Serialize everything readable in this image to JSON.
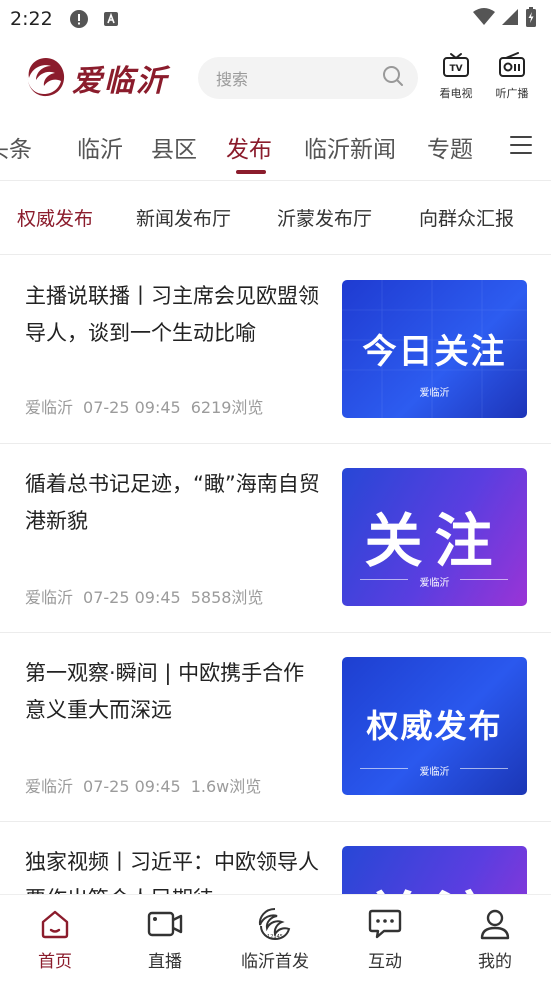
{
  "status_bar": {
    "time": "2:22"
  },
  "header": {
    "logo_text": "爱临沂",
    "search_placeholder": "搜索",
    "tv_label": "看电视",
    "radio_label": "听广播"
  },
  "tabs": [
    {
      "label": "头条"
    },
    {
      "label": "临沂"
    },
    {
      "label": "县区"
    },
    {
      "label": "发布"
    },
    {
      "label": "临沂新闻"
    },
    {
      "label": "专题"
    }
  ],
  "active_tab": "发布",
  "subtabs": [
    {
      "label": "权威发布"
    },
    {
      "label": "新闻发布厅"
    },
    {
      "label": "沂蒙发布厅"
    },
    {
      "label": "向群众汇报"
    }
  ],
  "news": [
    {
      "title": "主播说联播丨习主席会见欧盟领导人，谈到一个生动比喻",
      "source": "爱临沂",
      "time": "07-25 09:45",
      "views": "6219浏览",
      "thumb_text": "今日关注",
      "thumb_logo": "爱临沂"
    },
    {
      "title": "循着总书记足迹，“瞰”海南自贸港新貌",
      "source": "爱临沂",
      "time": "07-25 09:45",
      "views": "5858浏览",
      "thumb_text": "关注",
      "thumb_logo": "爱临沂"
    },
    {
      "title": "第一观察·瞬间 | 中欧携手合作意义重大而深远",
      "source": "爱临沂",
      "time": "07-25 09:45",
      "views": "1.6w浏览",
      "thumb_text": "权威发布",
      "thumb_logo": "爱临沂"
    },
    {
      "title": "独家视频丨习近平：中欧领导人要作出符合人民期待",
      "thumb_text": "关注"
    }
  ],
  "bottom_nav": [
    {
      "label": "首页"
    },
    {
      "label": "直播"
    },
    {
      "label": "临沂首发"
    },
    {
      "label": "互动"
    },
    {
      "label": "我的"
    }
  ],
  "colors": {
    "brand": "#8b1c2c",
    "thumb_blue": "#2747d6",
    "thumb_purple": "#6a3ad6"
  }
}
